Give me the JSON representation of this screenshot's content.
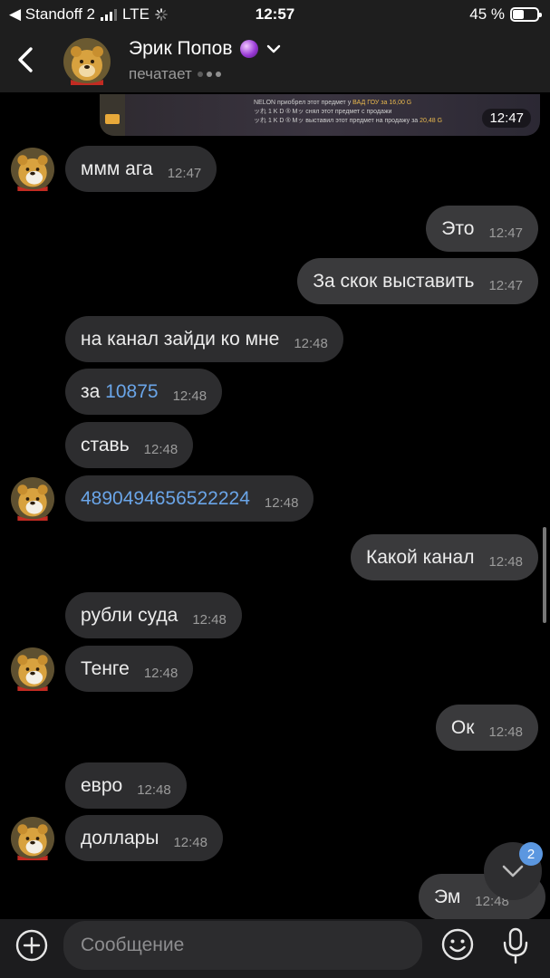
{
  "status_bar": {
    "back_app": "◀ Standoff 2",
    "network": "LTE",
    "time": "12:57",
    "battery": "45 %",
    "battery_level": 0.45
  },
  "header": {
    "contact_name": "Эрик Попов",
    "status": "печатает"
  },
  "shared_image": {
    "time": "12:47",
    "rows": [
      {
        "text": "NELON приобрел этот предмет у",
        "who": "ВАД ГОУ за",
        "price": "16,00 G"
      },
      {
        "text": "ッれ 1 K D ® Mッ снял этот предмет с продажи",
        "who": "",
        "price": ""
      },
      {
        "text": "ッれ 1 K D ® Mッ выставил этот предмет на продажу за",
        "who": "",
        "price": "20,48 G"
      }
    ]
  },
  "messages": [
    {
      "dir": "in",
      "text": "ммм ага",
      "time": "12:47"
    },
    {
      "dir": "out",
      "text": "Это",
      "time": "12:47"
    },
    {
      "dir": "out",
      "text": "За скок выставить",
      "time": "12:47"
    },
    {
      "dir": "in",
      "text": "на канал зайди ко мне",
      "time": "12:48"
    },
    {
      "dir": "in",
      "prefix": "за ",
      "link": "10875",
      "time": "12:48"
    },
    {
      "dir": "in",
      "text": "ставь",
      "time": "12:48"
    },
    {
      "dir": "in",
      "link": "4890494656522224",
      "time": "12:48"
    },
    {
      "dir": "out",
      "text": "Какой канал",
      "time": "12:48"
    },
    {
      "dir": "in",
      "text": "рубли суда",
      "time": "12:48"
    },
    {
      "dir": "in",
      "text": "Тенге",
      "time": "12:48"
    },
    {
      "dir": "out",
      "text": "Ок",
      "time": "12:48"
    },
    {
      "dir": "in",
      "text": "евро",
      "time": "12:48"
    },
    {
      "dir": "in",
      "text": "доллары",
      "time": "12:48"
    },
    {
      "dir": "out",
      "text": "Эм",
      "time": "12:48"
    }
  ],
  "scroll_down": {
    "badge": "2"
  },
  "composer": {
    "placeholder": "Сообщение"
  }
}
